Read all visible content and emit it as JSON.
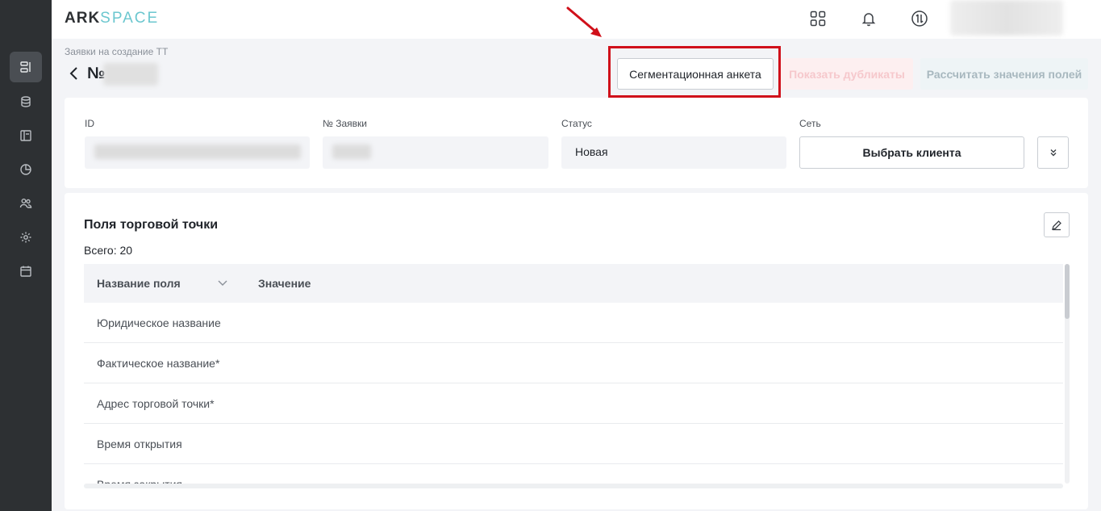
{
  "app": {
    "logo_ark": "ARK",
    "logo_space": "SPACE"
  },
  "sidebar": {
    "items": [
      {
        "icon": "requests-icon",
        "active": true
      },
      {
        "icon": "database-icon",
        "active": false
      },
      {
        "icon": "layout-icon",
        "active": false
      },
      {
        "icon": "chart-pie-icon",
        "active": false
      },
      {
        "icon": "users-icon",
        "active": false
      },
      {
        "icon": "gear-icon",
        "active": false
      },
      {
        "icon": "calendar-icon",
        "active": false
      }
    ]
  },
  "topbar": {
    "icons": [
      "apps-grid-icon",
      "bell-icon",
      "swap-icon"
    ]
  },
  "header": {
    "breadcrumb": "Заявки на создание ТТ",
    "title_prefix": "№",
    "buttons": {
      "segmentation": "Сегментационная анкета",
      "duplicates": "Показать дубликаты",
      "calculate": "Рассчитать значения полей"
    }
  },
  "info": {
    "id_label": "ID",
    "request_label": "№ Заявки",
    "status_label": "Статус",
    "status_value": "Новая",
    "network_label": "Сеть",
    "choose_client": "Выбрать клиента"
  },
  "fields": {
    "title": "Поля торговой точки",
    "total": "Всего: 20",
    "columns": {
      "name": "Название поля",
      "value": "Значение"
    },
    "rows": [
      "Юридическое название",
      "Фактическое название*",
      "Адрес торговой точки*",
      "Время открытия",
      "Время закрытия"
    ]
  },
  "colors": {
    "sidebar_bg": "#2d3033",
    "logo_accent": "#6cc7cf",
    "highlight": "#d0101a",
    "duplicates_bg": "#fdeff0",
    "calculate_bg": "#eef4f6"
  }
}
